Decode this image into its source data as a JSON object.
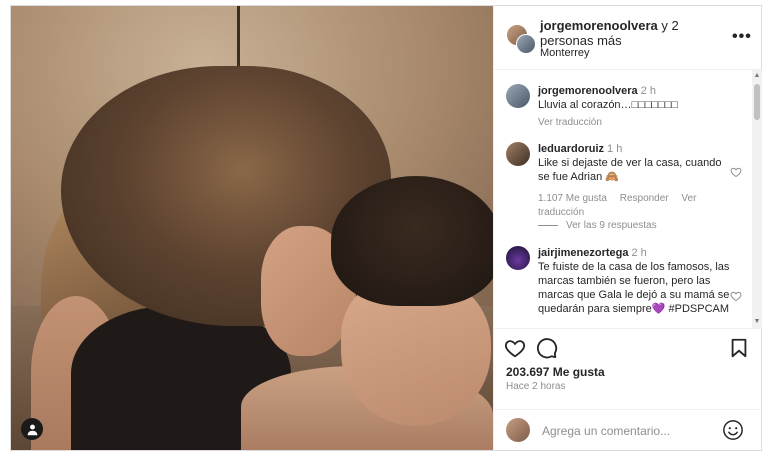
{
  "header": {
    "username": "jorgemorenoolvera",
    "and_more": "y 2 personas más",
    "location": "Monterrey",
    "more_icon": "more-horizontal-icon"
  },
  "comments": [
    {
      "username": "jorgemorenoolvera",
      "time": "2 h",
      "text": "Lluvia al corazón…",
      "emojis": "□□□□□□□",
      "actions": [
        "Ver traducción"
      ]
    },
    {
      "username": "leduardoruiz",
      "time": "1 h",
      "text": "Like si dejaste de ver la casa, cuando se fue Adrian",
      "emojis": "🙈",
      "actions": [
        "1.107 Me gusta",
        "Responder",
        "Ver traducción"
      ],
      "replies": "Ver las 9 respuestas"
    },
    {
      "username": "jairjimenezortega",
      "time": "2 h",
      "text": "Te fuiste de la casa de los famosos, las marcas también se fueron, pero las marcas que Gala le dejó a su mamá se quedarán para siempre💜 #PDSPCAM",
      "actions": []
    }
  ],
  "actions": {
    "likes": "203.697 Me gusta",
    "time_ago": "Hace 2 horas",
    "comment_placeholder": "Agrega un comentario..."
  },
  "colors": {
    "border": "#dbdbdb",
    "text": "#262626",
    "muted": "#8e8e8e"
  }
}
